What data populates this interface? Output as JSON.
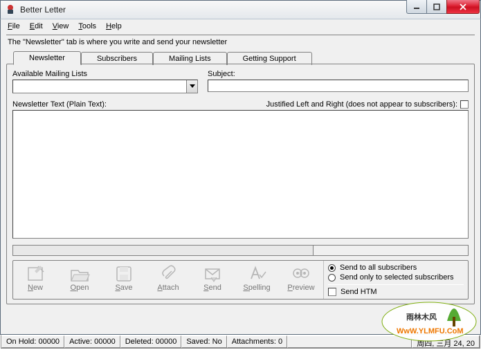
{
  "window": {
    "title": "Better Letter"
  },
  "menu": {
    "file": "File",
    "edit": "Edit",
    "view": "View",
    "tools": "Tools",
    "help": "Help"
  },
  "hint": "The \"Newsletter\" tab is where you write and send your newsletter",
  "tabs": {
    "newsletter": "Newsletter",
    "subscribers": "Subscribers",
    "mailing": "Mailing Lists",
    "support": "Getting Support"
  },
  "fields": {
    "available_label": "Available Mailing Lists",
    "available_value": "",
    "subject_label": "Subject:",
    "subject_value": "",
    "editor_label": "Newsletter Text (Plain Text):",
    "justified_label": "Justified Left and Right (does not appear to subscribers):"
  },
  "toolbar": {
    "new": "New",
    "open": "Open",
    "save": "Save",
    "attach": "Attach",
    "send": "Send",
    "spelling": "Spelling",
    "preview": "Preview"
  },
  "send_opts": {
    "all": "Send to all subscribers",
    "selected": "Send only to selected subscribers",
    "html": "Send HTM"
  },
  "status": {
    "hold": "On Hold: 00000",
    "active": "Active: 00000",
    "deleted": "Deleted: 00000",
    "saved": "Saved: No",
    "attach": "Attachments: 0",
    "date": "周四, 三月 24, 20"
  },
  "watermark": {
    "brand_cn": "雨林木风",
    "url": "WwW.YLMFU.CoM"
  }
}
